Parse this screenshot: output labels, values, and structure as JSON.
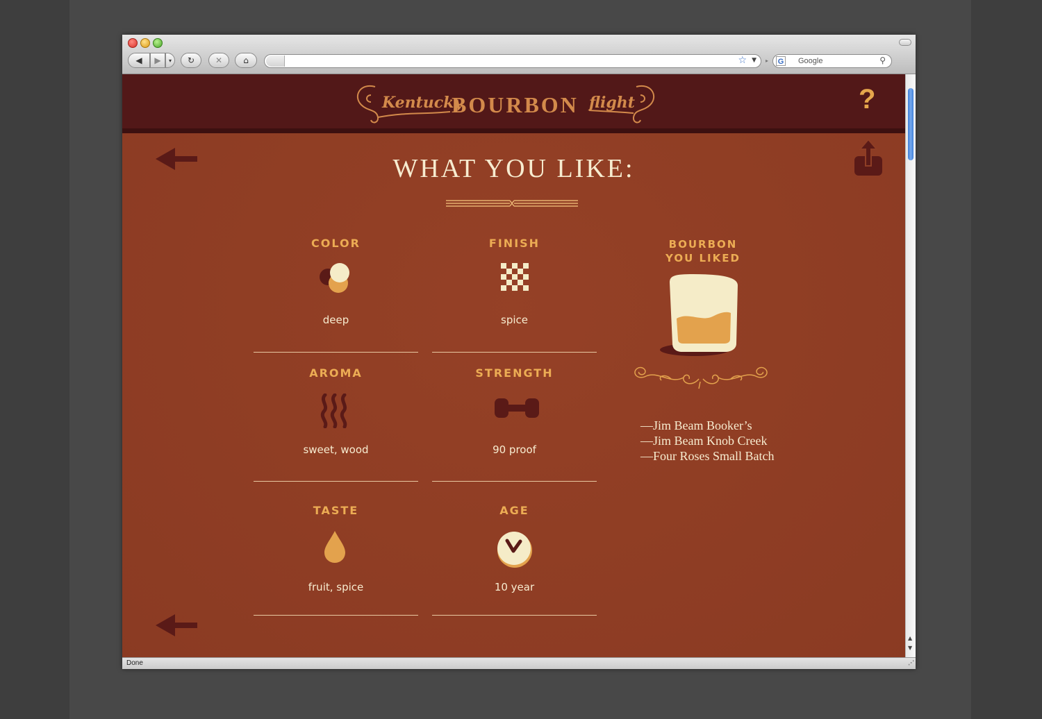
{
  "browser": {
    "search_engine": "Google",
    "status": "Done",
    "buttons": {
      "back": "◀",
      "forward": "▶",
      "history": "▾",
      "reload": "↻",
      "stop": "✕",
      "home": "⌂"
    },
    "icons": {
      "bookmark": "☆",
      "url_dropdown": "▼",
      "search": "⚲",
      "search_engine_logo": "G",
      "separator": "▸",
      "scroll_up": "▲",
      "scroll_down": "▼",
      "resize": "⋰"
    }
  },
  "header": {
    "logo_kentucky": "Kentucky",
    "logo_bourbon": "BOURBON",
    "logo_flight": "flight",
    "help_label": "?"
  },
  "page": {
    "heading": "WHAT YOU LIKE:"
  },
  "attributes": [
    {
      "label": "COLOR",
      "value": "deep",
      "icon": "color-circles-icon"
    },
    {
      "label": "FINISH",
      "value": "spice",
      "icon": "checkerboard-icon"
    },
    {
      "label": "AROMA",
      "value": "sweet, wood",
      "icon": "steam-waves-icon"
    },
    {
      "label": "STRENGTH",
      "value": "90 proof",
      "icon": "dumbbell-icon"
    },
    {
      "label": "TASTE",
      "value": "fruit, spice",
      "icon": "droplet-icon"
    },
    {
      "label": "AGE",
      "value": "10 year",
      "icon": "clock-icon"
    }
  ],
  "liked": {
    "title_line1": "BOURBON",
    "title_line2": "YOU LIKED",
    "items": [
      "—Jim Beam Booker’s",
      "—Jim Beam Knob Creek",
      "—Four Roses Small Batch"
    ]
  },
  "colors": {
    "background": "#8f3e25",
    "header": "#521818",
    "accent": "#ecac54",
    "cream": "#f7ecd0",
    "dark_icon": "#5a1a17"
  }
}
